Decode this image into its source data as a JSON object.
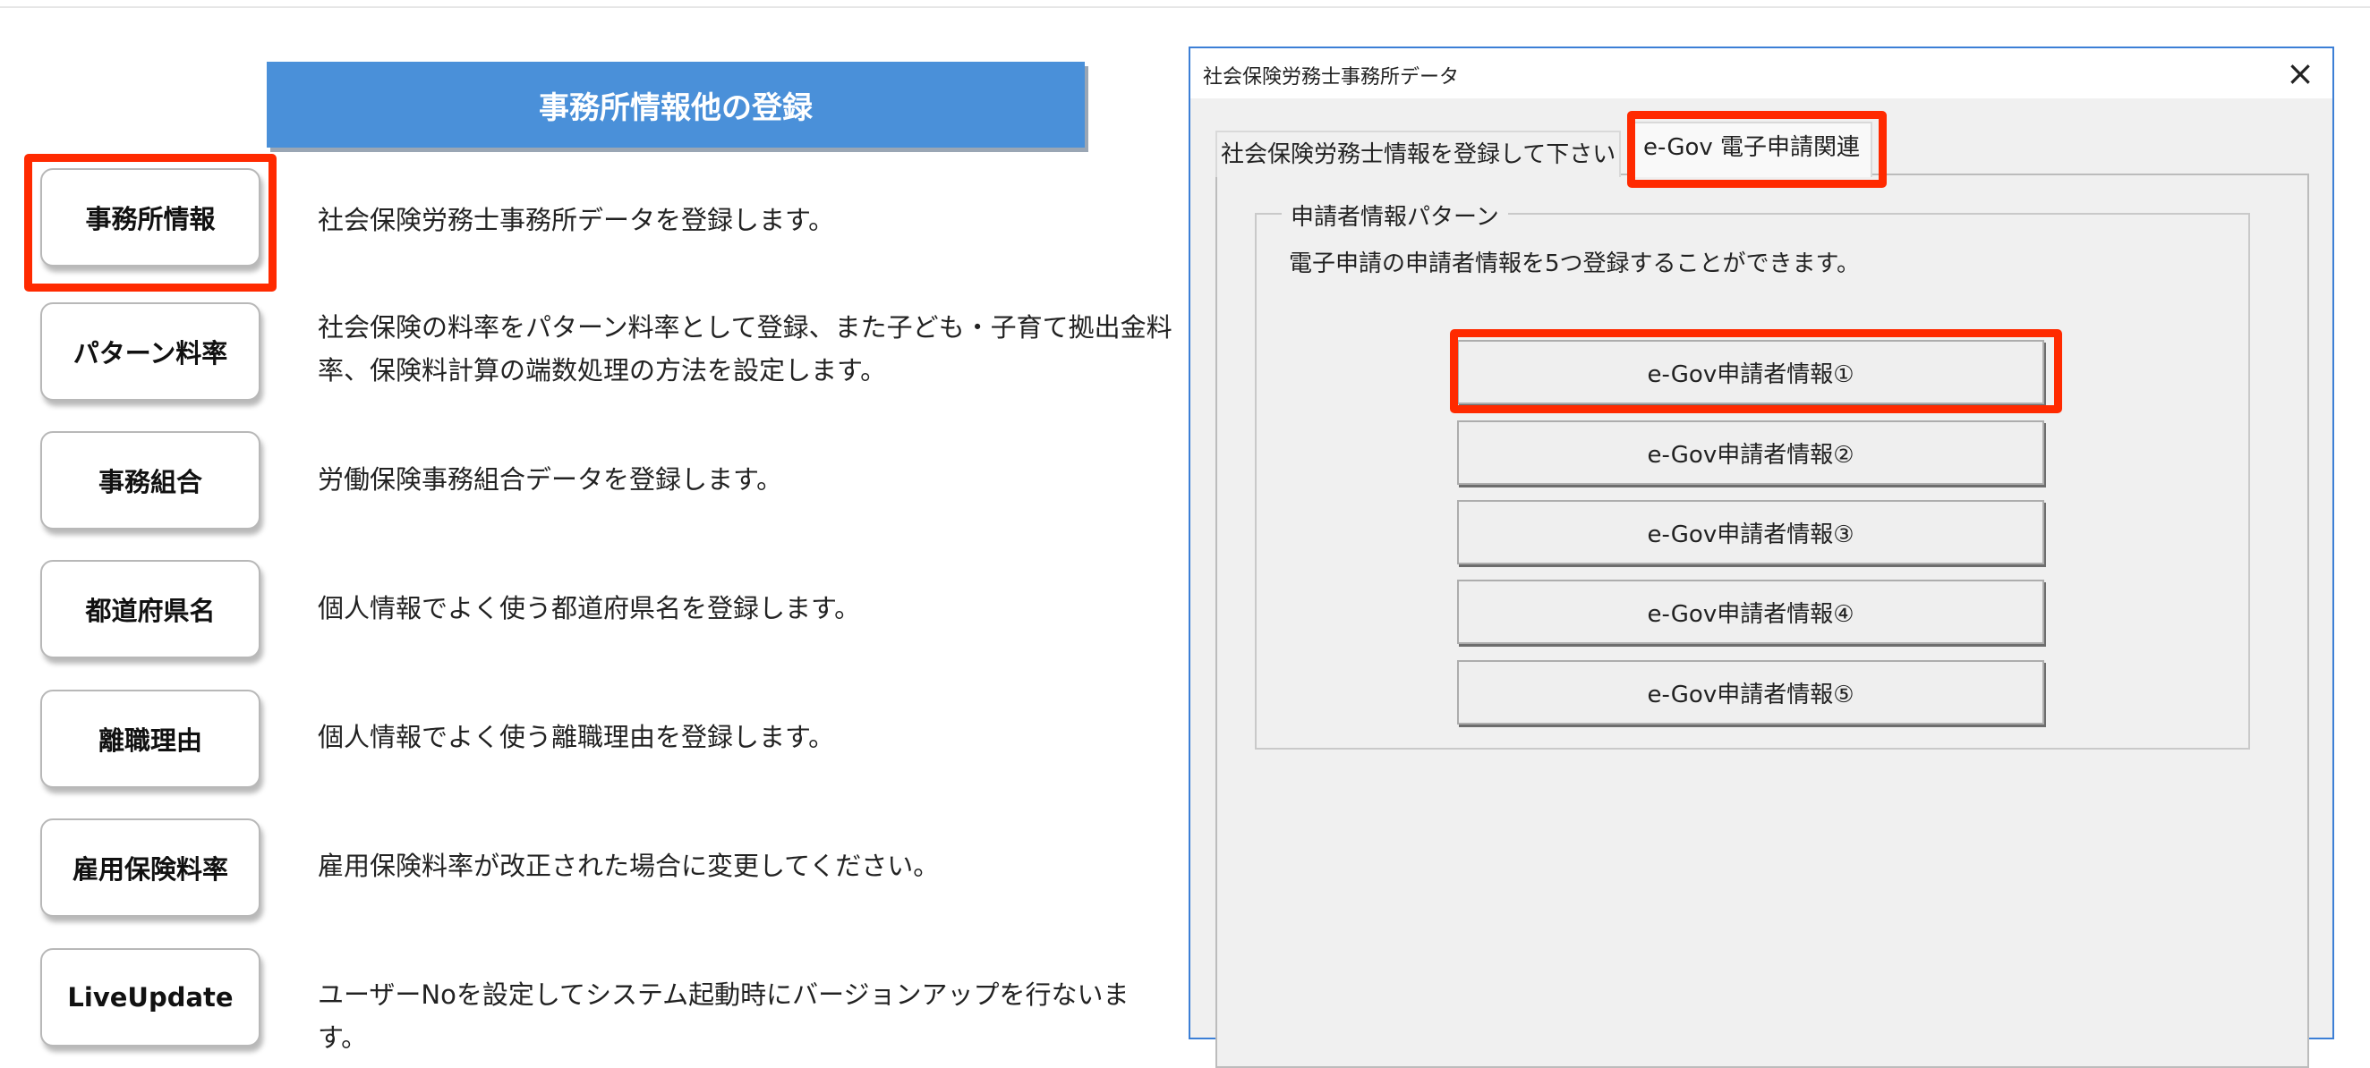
{
  "banner": {
    "title": "事務所情報他の登録"
  },
  "menu": [
    {
      "label": "事務所情報",
      "desc": "社会保険労務士事務所データを登録します。"
    },
    {
      "label": "パターン料率",
      "desc": "社会保険の料率をパターン料率として登録、また子ども・子育て拠出金料率、保険料計算の端数処理の方法を設定します。"
    },
    {
      "label": "事務組合",
      "desc": "労働保険事務組合データを登録します。"
    },
    {
      "label": "都道府県名",
      "desc": "個人情報でよく使う都道府県名を登録します。"
    },
    {
      "label": "離職理由",
      "desc": "個人情報でよく使う離職理由を登録します。"
    },
    {
      "label": "雇用保険料率",
      "desc": "雇用保険料率が改正された場合に変更してください。"
    },
    {
      "label": "LiveUpdate",
      "desc": "ユーザーNoを設定してシステム起動時にバージョンアップを行ないます。"
    }
  ],
  "dialog": {
    "title": "社会保険労務士事務所データ",
    "close_glyph": "×",
    "tabs": [
      {
        "label": "社会保険労務士情報を登録して下さい"
      },
      {
        "label": "e-Gov 電子申請関連"
      }
    ],
    "group": {
      "legend": "申請者情報パターン",
      "desc": "電子申請の申請者情報を5つ登録することができます。",
      "buttons": [
        {
          "label": "e-Gov申請者情報①"
        },
        {
          "label": "e-Gov申請者情報②"
        },
        {
          "label": "e-Gov申請者情報③"
        },
        {
          "label": "e-Gov申請者情報④"
        },
        {
          "label": "e-Gov申請者情報⑤"
        }
      ]
    }
  },
  "colors": {
    "banner": "#4a90d9",
    "highlight": "#ff2a00",
    "dialog_border": "#3c7fd6"
  }
}
